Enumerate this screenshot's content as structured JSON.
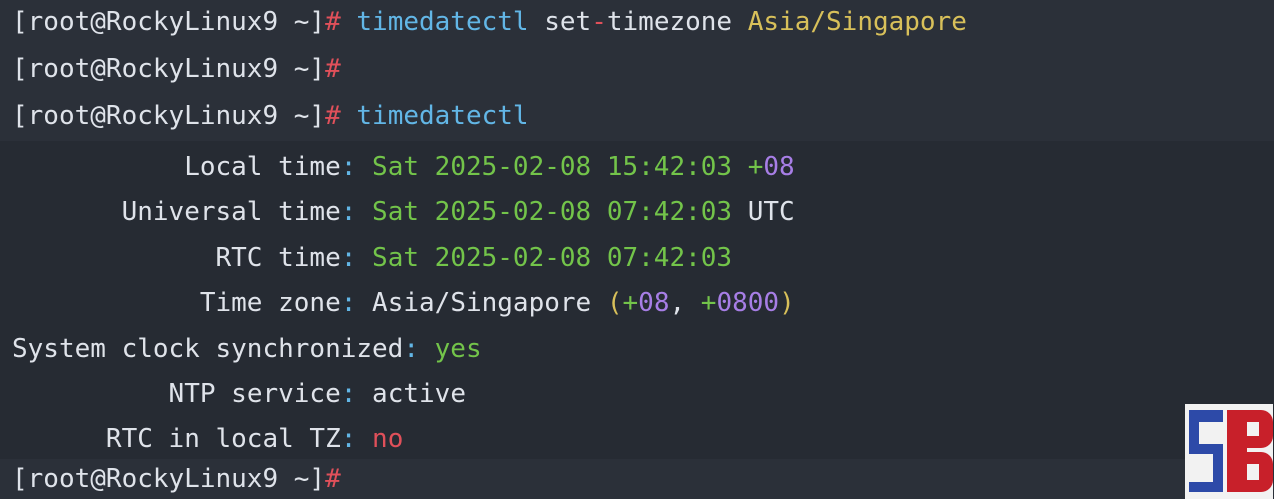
{
  "terminal": {
    "prompt": "[root@RockyLinux9 ~]",
    "hash": "#",
    "command1": {
      "name": "timedatectl",
      "sep1": " ",
      "sub": "set",
      "dash": "-",
      "arg": "timezone",
      "sep2": " ",
      "value": "Asia/Singapore"
    },
    "command3": {
      "name": "timedatectl"
    },
    "fields": [
      {
        "label": "Local time",
        "colon": ":",
        "date": "Sat 2025-02-08 15:42:03",
        "suffix_sign": "+",
        "suffix_num": "08"
      },
      {
        "label": "Universal time",
        "colon": ":",
        "date": "Sat 2025-02-08 07:42:03",
        "suffix": "UTC"
      },
      {
        "label": "RTC time",
        "colon": ":",
        "date": "Sat 2025-02-08 07:42:03"
      },
      {
        "label": "Time zone",
        "colon": ":",
        "zone": "Asia/Singapore",
        "open": "(",
        "p1_sign": "+",
        "p1_num": "08",
        "comma": ",",
        "p2_sign": "+",
        "p2_num": "0800",
        "close": ")"
      },
      {
        "label": "System clock synchronized",
        "colon": ":",
        "value": "yes"
      },
      {
        "label": "NTP service",
        "colon": ":",
        "value": "active"
      },
      {
        "label": "RTC in local TZ",
        "colon": ":",
        "value": "no"
      }
    ]
  },
  "colors": {
    "background": "#262b33",
    "prompt_hash": "#e0505a",
    "command": "#62b6e6",
    "argument": "#d8c05a",
    "date": "#73c44a",
    "number": "#a77ee6"
  }
}
